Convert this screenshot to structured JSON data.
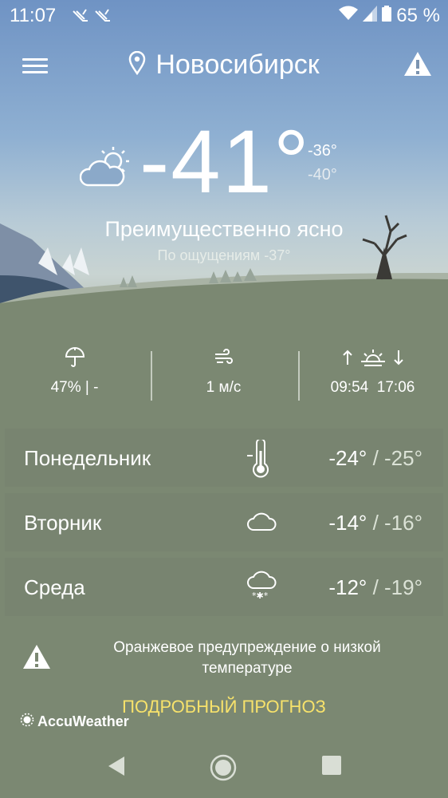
{
  "status_bar": {
    "time": "11:07",
    "battery": "65 %"
  },
  "header": {
    "city": "Новосибирск"
  },
  "current": {
    "temp": "-41°",
    "high": "-36°",
    "low": "-40°",
    "condition": "Преимущественно ясно",
    "feels_like": "По ощущениям -37°"
  },
  "stats": {
    "precipitation": "47% | -",
    "wind": "1 м/с",
    "sunrise": "09:54",
    "sunset": "17:06"
  },
  "days": [
    {
      "name": "Понедельник",
      "icon": "thermometer-icon",
      "high": "-24°",
      "low": "/ -25°"
    },
    {
      "name": "Вторник",
      "icon": "cloud-icon",
      "high": "-14°",
      "low": "/ -16°"
    },
    {
      "name": "Среда",
      "icon": "snow-cloud-icon",
      "high": "-12°",
      "low": "/ -19°"
    }
  ],
  "warning": {
    "text": "Оранжевое предупреждение о низкой температуре"
  },
  "footer": {
    "detailed_forecast": "ПОДРОБНЫЙ ПРОГНОЗ",
    "brand": "AccuWeather"
  },
  "colors": {
    "accent": "#f7e26b",
    "ground": "#7b8872",
    "sky_top": "#6f93c4"
  }
}
